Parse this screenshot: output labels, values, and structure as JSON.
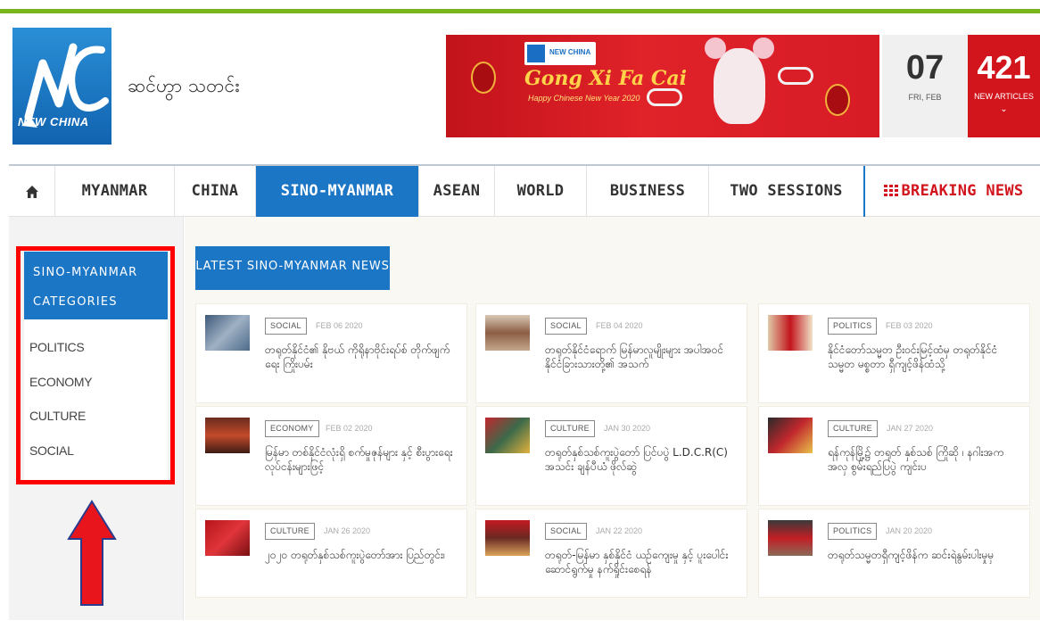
{
  "header": {
    "site_name": "ဆင်ဟွာ သတင်း",
    "logo_text": "NEW CHINA",
    "banner": {
      "logo_text": "NEW CHINA",
      "title": "Gong Xi Fa Cai",
      "subtitle": "Happy Chinese New Year 2020"
    },
    "date": {
      "day": "07",
      "label": "FRI, FEB"
    },
    "articles": {
      "count": "421",
      "label": "NEW ARTICLES",
      "chevron": "⌄"
    }
  },
  "nav": {
    "home_icon": "home-icon",
    "items": [
      "MYANMAR",
      "CHINA",
      "SINO-MYANMAR",
      "ASEAN",
      "WORLD",
      "BUSINESS",
      "TWO SESSIONS"
    ],
    "active": "SINO-MYANMAR",
    "breaking": "BREAKING NEWS",
    "breaking_icon": "grid-icon"
  },
  "sidebar": {
    "header": "SINO-MYANMAR CATEGORIES",
    "items": [
      "POLITICS",
      "ECONOMY",
      "CULTURE",
      "SOCIAL"
    ]
  },
  "latest": {
    "tab_label": "LATEST SINO-MYANMAR NEWS"
  },
  "articles": [
    {
      "tag": "SOCIAL",
      "date": "FEB 06 2020",
      "title": "တရုတ်နိုင်ငံ၏ နိုဗယ် ကိုရိုနာဗိုင်းရပ်စ် တိုက်ဖျက်ရေး ကြိုးပမ်း"
    },
    {
      "tag": "SOCIAL",
      "date": "FEB 04 2020",
      "title": "တရုတ်နိုင်ငံရောက် မြန်မာလူမျိုးများ အပါအဝင် နိုင်ငံခြားသားတို့၏ အသက်"
    },
    {
      "tag": "POLITICS",
      "date": "FEB 03 2020",
      "title": "နိုင်ငံတော်သမ္မတ ဦးဝင်းမြင့်ထံမှ တရုတ်နိုင်ငံ သမ္မတ မစ္စတာ ရှီကျင့်ဖိန်ထံသို့"
    },
    {
      "tag": "ECONOMY",
      "date": "FEB 02 2020",
      "title": "မြန်မာ တစ်နိုင်ငံလုံးရှိ စက်မှုဇုန်များ နှင့် စီးပွားရေး လုပ်ငန်းများဖြင့်"
    },
    {
      "tag": "CULTURE",
      "date": "JAN 30 2020",
      "title": "တရုတ်နှစ်သစ်ကူးပွဲတော် ပြင်ပပွဲ L.D.C.R(C) အသင်း ချန်ပီယံ ဖိုလ်ဆွဲ"
    },
    {
      "tag": "CULTURE",
      "date": "JAN 27 2020",
      "title": "ရန်ကုန်မြို့၌ တရုတ် နှစ်သစ် ကြိုဆို ၊ နဂါးအကအလှ စွမ်းရည်ပြပွဲ ကျင်းပ"
    },
    {
      "tag": "CULTURE",
      "date": "JAN 26 2020",
      "title": "၂၀၂၀ တရုတ်နှစ်သစ်ကူးပွဲတော်အား ပြည်တွင်း၊"
    },
    {
      "tag": "SOCIAL",
      "date": "JAN 22 2020",
      "title": "တရုတ်-မြန်မာ နှစ်နိုင်ငံ ယဉ်ကျေးမှု နှင့် ပူးပေါင်းဆောင်ရွက်မှု နက်ရှိုင်းစေရန်"
    },
    {
      "tag": "POLITICS",
      "date": "JAN 20 2020",
      "title": "တရုတ်သမ္မတရှီကျင့်ဖိန်က ဆင်းရဲနွမ်းပါးမှုမှ"
    }
  ]
}
